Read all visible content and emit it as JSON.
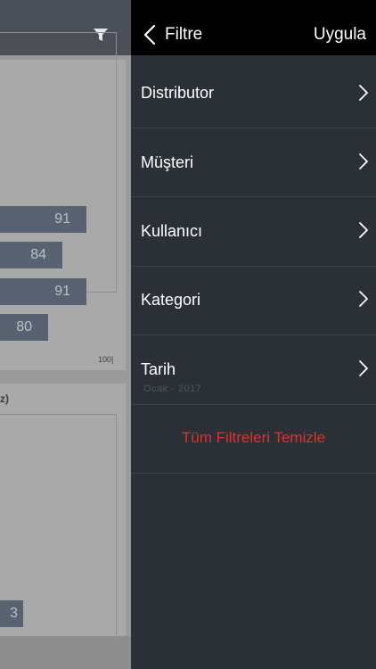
{
  "background": {
    "bars_card1": [
      "91",
      "84",
      "91",
      "80"
    ],
    "axis_tick": "100|",
    "card2_title": "z)",
    "bar_card2": "3"
  },
  "panel": {
    "title": "Filtre",
    "apply_label": "Uygula",
    "rows": [
      {
        "label": "Distributor"
      },
      {
        "label": "Müşteri"
      },
      {
        "label": "Kullanıcı"
      },
      {
        "label": "Kategori"
      },
      {
        "label": "Tarih",
        "sub": "Ocak - 2017"
      }
    ],
    "clear_label": "Tüm Filtreleri Temizle",
    "clear_color": "#e3302a"
  }
}
